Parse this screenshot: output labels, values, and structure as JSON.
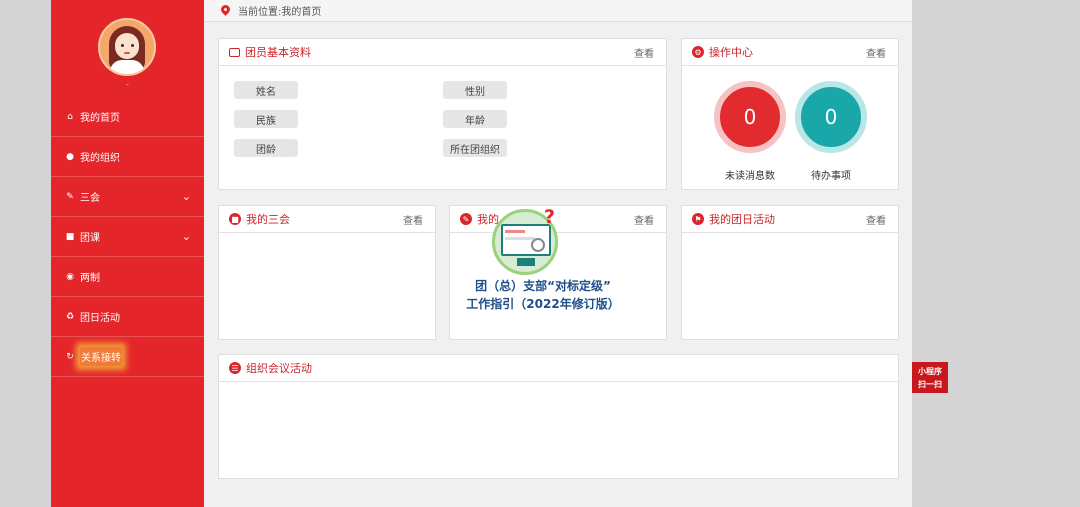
{
  "sidebar": {
    "user_name": "-",
    "items": [
      {
        "label": "我的首页",
        "icon": "home-icon"
      },
      {
        "label": "我的组织",
        "icon": "users-icon"
      },
      {
        "label": "三会",
        "icon": "edit-icon"
      },
      {
        "label": "团课",
        "icon": "folder-icon"
      },
      {
        "label": "两制",
        "icon": "target-icon"
      },
      {
        "label": "团日活动",
        "icon": "recycle-icon"
      },
      {
        "label": "关系接转",
        "icon": "refresh-icon"
      }
    ]
  },
  "breadcrumb": {
    "text": "当前位置:我的首页"
  },
  "panels": {
    "profile": {
      "title": "团员基本资料",
      "more": "查看",
      "fields": {
        "name": "姓名",
        "gender": "性别",
        "ethnicity": "民族",
        "age": "年龄",
        "league_age": "团龄",
        "org": "所在团组织"
      }
    },
    "ops": {
      "title": "操作中心",
      "more": "查看",
      "unread_count": "0",
      "unread_label": "未读消息数",
      "todo_count": "0",
      "todo_label": "待办事项"
    },
    "three": {
      "title": "我的三会",
      "more": "查看"
    },
    "mid": {
      "title": "我的",
      "more": "查看",
      "promo_line1": "团（总）支部“对标定级”",
      "promo_line2": "工作指引（2022年修订版）"
    },
    "activity": {
      "title": "我的团日活动",
      "more": "查看"
    },
    "meeting": {
      "title": "组织会议活动"
    }
  },
  "float_button": {
    "line1": "小程序",
    "line2": "扫一扫"
  },
  "colors": {
    "primary_red": "#e4262a",
    "teal": "#1aa7a9",
    "promo_blue": "#1f4f8a"
  }
}
